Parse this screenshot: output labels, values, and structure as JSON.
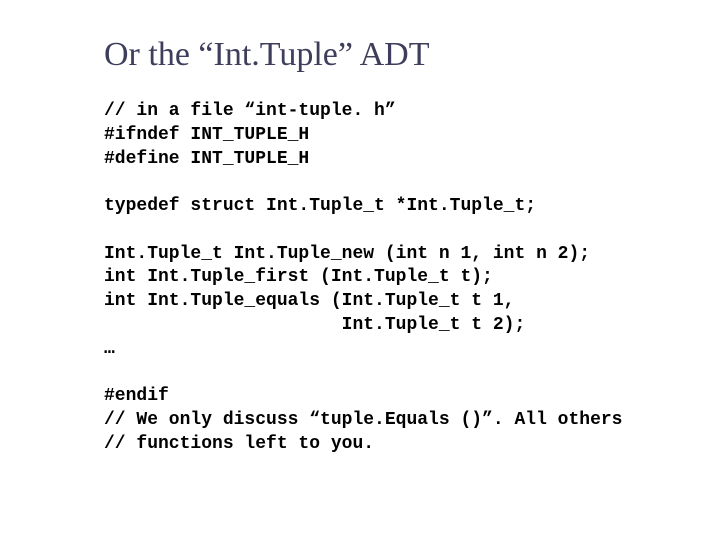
{
  "title": "Or the “Int.Tuple” ADT",
  "code": {
    "l1": "// in a file “int-tuple. h”",
    "l2": "#ifndef INT_TUPLE_H",
    "l3": "#define INT_TUPLE_H",
    "l4": "",
    "l5": "typedef struct Int.Tuple_t *Int.Tuple_t;",
    "l6": "",
    "l7": "Int.Tuple_t Int.Tuple_new (int n 1, int n 2);",
    "l8": "int Int.Tuple_first (Int.Tuple_t t);",
    "l9": "int Int.Tuple_equals (Int.Tuple_t t 1,",
    "l10": "                      Int.Tuple_t t 2);",
    "l11": "…",
    "l12": "",
    "l13": "#endif",
    "l14": "// We only discuss “tuple.Equals ()”. All others",
    "l15": "// functions left to you."
  }
}
